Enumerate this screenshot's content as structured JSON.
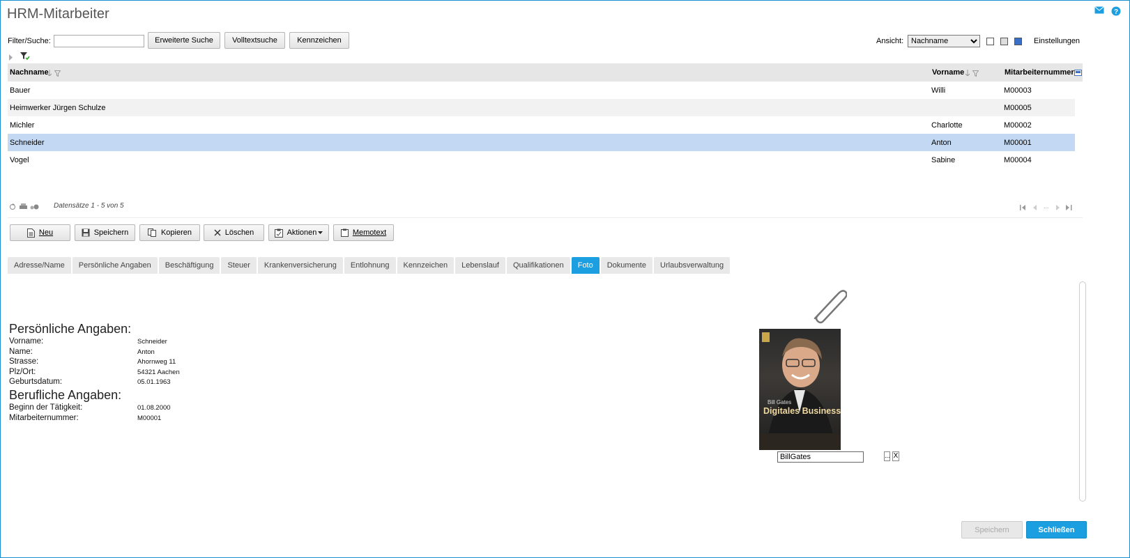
{
  "app": {
    "title": "HRM-Mitarbeiter"
  },
  "toolbar": {
    "filter_label": "Filter/Suche:",
    "filter_value": "",
    "buttons": [
      "Erweiterte Suche",
      "Volltextsuche",
      "Kennzeichen"
    ],
    "view_label": "Ansicht:",
    "view_selected": "Nachname",
    "settings_label": "Einstellungen"
  },
  "grid": {
    "columns": [
      "Nachname",
      "Vorname",
      "Mitarbeiternummer"
    ],
    "rows": [
      {
        "nachname": "Bauer",
        "vorname": "Willi",
        "nummer": "M00003"
      },
      {
        "nachname": "Heimwerker Jürgen Schulze",
        "vorname": "",
        "nummer": "M00005"
      },
      {
        "nachname": "Michler",
        "vorname": "Charlotte",
        "nummer": "M00002"
      },
      {
        "nachname": "Schneider",
        "vorname": "Anton",
        "nummer": "M00001"
      },
      {
        "nachname": "Vogel",
        "vorname": "Sabine",
        "nummer": "M00004"
      }
    ],
    "selected_row": 3,
    "pager_text": "Datensätze 1 - 5 von 5",
    "pager_dots": "..."
  },
  "actions": [
    "Neu",
    "Speichern",
    "Kopieren",
    "Löschen",
    "Aktionen",
    "Memotext"
  ],
  "tabs": [
    "Adresse/Name",
    "Persönliche Angaben",
    "Beschäftigung",
    "Steuer",
    "Krankenversicherung",
    "Entlohnung",
    "Kennzeichen",
    "Lebenslauf",
    "Qualifikationen",
    "Foto",
    "Dokumente",
    "Urlaubsverwaltung"
  ],
  "active_tab": "Foto",
  "detail": {
    "personal_title": "Persönliche Angaben:",
    "personal": [
      {
        "label": "Vorname:",
        "value": "Schneider"
      },
      {
        "label": "Name:",
        "value": "Anton"
      },
      {
        "label": "Strasse:",
        "value": "Ahornweg 11"
      },
      {
        "label": "Plz/Ort:",
        "value": "54321 Aachen"
      },
      {
        "label": "Geburtsdatum:",
        "value": "05.01.1963"
      }
    ],
    "job_title": "Berufliche Angaben:",
    "job": [
      {
        "label": "Beginn der Tätigkeit:",
        "value": "01.08.2000"
      },
      {
        "label": "Mitarbeiternummer:",
        "value": "M00001"
      }
    ]
  },
  "photo": {
    "cover_author": "Bill Gates",
    "cover_title": "Digitales Business",
    "file_name": "BillGates",
    "browse_label": "...",
    "clear_label": "X"
  },
  "footer": {
    "save_label": "Speichern",
    "close_label": "Schließen"
  },
  "colors": {
    "accent": "#1c9fe0",
    "selected_row": "#c3d9f3",
    "header": "#e6e6e6"
  }
}
